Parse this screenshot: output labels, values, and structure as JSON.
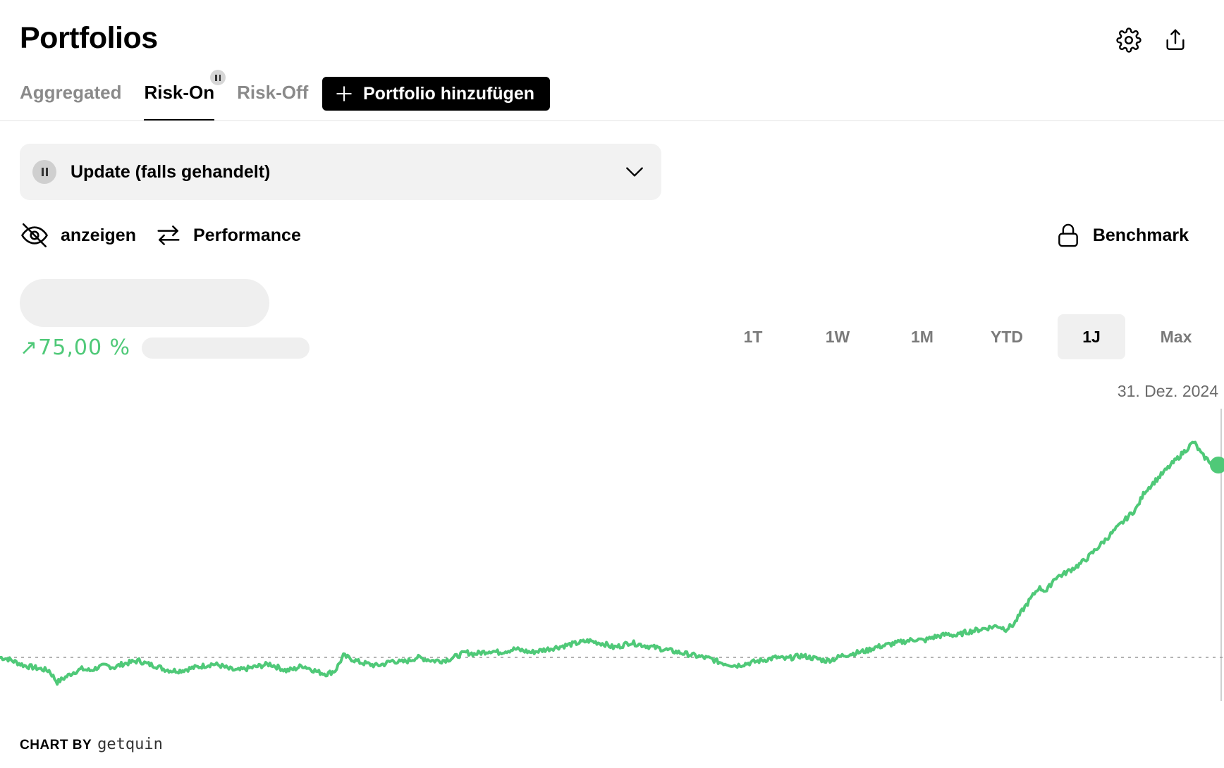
{
  "header": {
    "title": "Portfolios",
    "actions": [
      {
        "icon": "gear-icon",
        "label": "Settings"
      },
      {
        "icon": "share-icon",
        "label": "Share"
      }
    ]
  },
  "tabs": [
    {
      "label": "Aggregated",
      "active": false
    },
    {
      "label": "Risk-On",
      "active": true,
      "paused": true
    },
    {
      "label": "Risk-Off",
      "active": false
    }
  ],
  "add_portfolio_label": "Portfolio hinzufügen",
  "update_select": {
    "value": "Update (falls gehandelt)",
    "status_icon": "pause-icon"
  },
  "controls": {
    "visibility_label": "anzeigen",
    "performance_label": "Performance",
    "benchmark_label": "Benchmark"
  },
  "summary": {
    "change_arrow": "↗",
    "change_value": "75,00 %"
  },
  "range_tabs": [
    {
      "label": "1T",
      "active": false
    },
    {
      "label": "1W",
      "active": false
    },
    {
      "label": "1M",
      "active": false
    },
    {
      "label": "YTD",
      "active": false
    },
    {
      "label": "1J",
      "active": true
    },
    {
      "label": "Max",
      "active": false
    }
  ],
  "chart_date": "31. Dez. 2024",
  "chart_credit": {
    "prefix": "CHART BY",
    "brand": "getquin"
  },
  "colors": {
    "accent_green": "#4fc978",
    "primary_button": "#000000",
    "skeleton": "#efefef"
  },
  "chart_data": {
    "type": "line",
    "baseline_value": 100,
    "ylim": [
      80,
      250
    ],
    "values": [
      100,
      99,
      97,
      95,
      94,
      93,
      92,
      85,
      88,
      91,
      93,
      92,
      94,
      95,
      94,
      96,
      97,
      98,
      96,
      95,
      93,
      92,
      92,
      93,
      94,
      95,
      96,
      95,
      93,
      92,
      93,
      94,
      95,
      96,
      94,
      92,
      93,
      95,
      93,
      91,
      90,
      92,
      101,
      99,
      97,
      96,
      95,
      96,
      98,
      97,
      98,
      100,
      99,
      98,
      98,
      99,
      101,
      103,
      102,
      103,
      104,
      103,
      104,
      105,
      104,
      103,
      104,
      105,
      106,
      107,
      108,
      109,
      110,
      109,
      108,
      106,
      107,
      109,
      108,
      107,
      106,
      105,
      104,
      103,
      102,
      101,
      100,
      99,
      97,
      96,
      95,
      96,
      97,
      98,
      99,
      100,
      99,
      100,
      101,
      100,
      99,
      98,
      99,
      101,
      102,
      103,
      104,
      106,
      107,
      108,
      109,
      110,
      111,
      110,
      112,
      113,
      114,
      113,
      115,
      116,
      117,
      118,
      119,
      117,
      120,
      128,
      135,
      142,
      140,
      148,
      150,
      153,
      156,
      160,
      165,
      170,
      175,
      180,
      185,
      190,
      200,
      205,
      210,
      215,
      220,
      225,
      230,
      222,
      218,
      216
    ]
  }
}
